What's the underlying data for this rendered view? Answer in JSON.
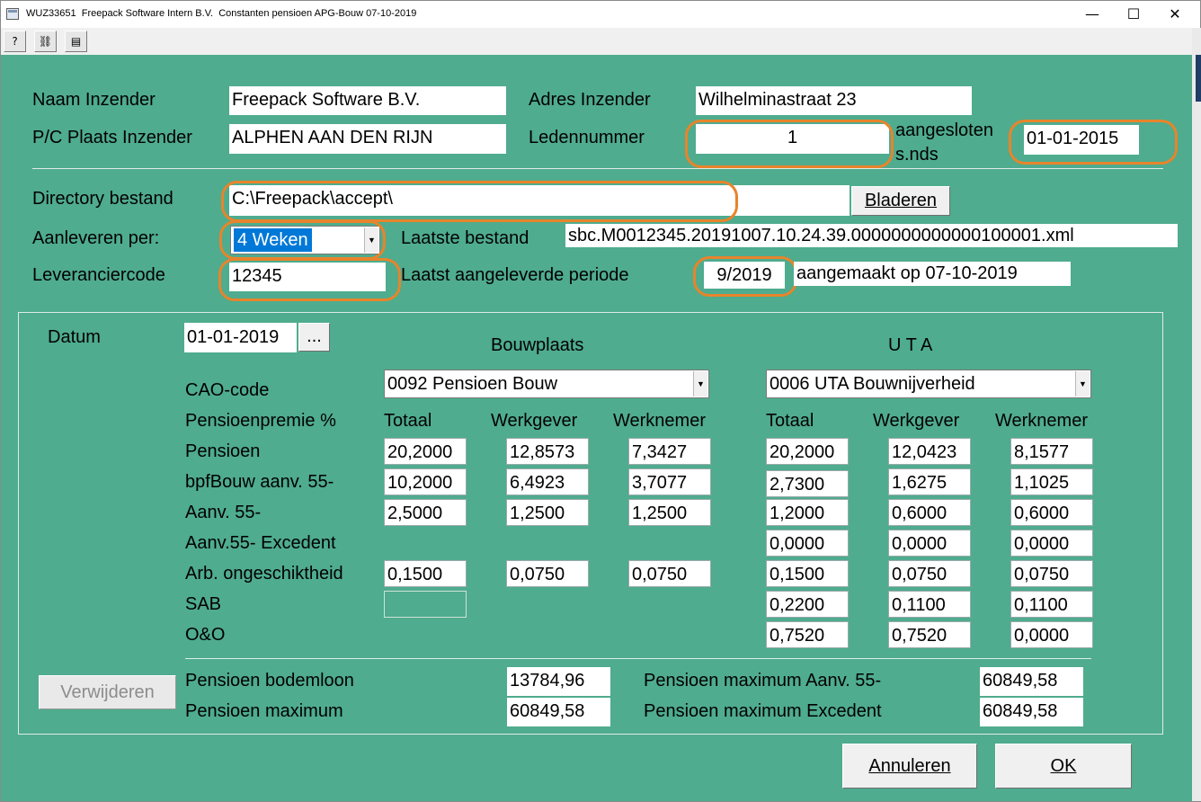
{
  "window": {
    "title": "WUZ33651  Freepack Software Intern B.V.  Constanten pensioen APG-Bouw 07-10-2019",
    "minimize": "—",
    "maximize": "☐",
    "close": "✕"
  },
  "toolbar": {
    "help_icon": "?",
    "find_icon": "⛓",
    "print_icon": "▤"
  },
  "header": {
    "naam_label": "Naam  Inzender",
    "naam_value": "Freepack Software B.V.",
    "adres_label": "Adres Inzender",
    "adres_value": "Wilhelminastraat 23",
    "pc_label": "P/C Plaats Inzender",
    "pc_value": "ALPHEN AAN DEN RIJN",
    "leden_label": "Ledennummer",
    "leden_value": "1",
    "aangesloten_label_1": "aangesloten",
    "aangesloten_label_2": "s.nds",
    "aangesloten_value": "01-01-2015",
    "directory_label": "Directory bestand",
    "directory_value": "C:\\Freepack\\accept\\",
    "bladeren": "Bladeren",
    "aanleveren_label": "Aanleveren per:",
    "aanleveren_value": "4 Weken",
    "laatste_label": "Laatste bestand",
    "laatste_value": "sbc.M0012345.20191007.10.24.39.0000000000000100001.xml",
    "leverancier_label": "Leveranciercode",
    "leverancier_value": "12345",
    "periode_label": "Laatst aangeleverde periode",
    "periode_value": "9/2019",
    "aangemaakt_value": "aangemaakt op 07-10-2019"
  },
  "group": {
    "datum_label": "Datum",
    "datum_value": "01-01-2019",
    "datum_button": "...",
    "bouwplaats_title": "Bouwplaats",
    "uta_title": "U T A",
    "cao_label": "CAO-code",
    "cao_bouw": "0092 Pensioen Bouw",
    "cao_uta": "0006 UTA Bouwnijverheid",
    "premie_label": "Pensioenpremie %",
    "col_totaal": "Totaal",
    "col_werkgever": "Werkgever",
    "col_werknemer": "Werknemer",
    "rows": [
      {
        "label": "Pensioen",
        "b": [
          "20,2000",
          "12,8573",
          "7,3427"
        ],
        "u": [
          "20,2000",
          "12,0423",
          "8,1577"
        ]
      },
      {
        "label": "bpfBouw aanv. 55-",
        "b": [
          "10,2000",
          "6,4923",
          "3,7077"
        ],
        "u": [
          "2,7300",
          "1,6275",
          "1,1025"
        ]
      },
      {
        "label": "Aanv. 55-",
        "b": [
          "2,5000",
          "1,2500",
          "1,2500"
        ],
        "u": [
          "1,2000",
          "0,6000",
          "0,6000"
        ]
      },
      {
        "label": "Aanv.55- Excedent",
        "u": [
          "0,0000",
          "0,0000",
          "0,0000"
        ]
      },
      {
        "label": "Arb. ongeschiktheid",
        "b": [
          "0,1500",
          "0,0750",
          "0,0750"
        ],
        "u": [
          "0,1500",
          "0,0750",
          "0,0750"
        ]
      },
      {
        "label": "SAB",
        "u": [
          "0,2200",
          "0,1100",
          "0,1100"
        ]
      },
      {
        "label": "O&O",
        "u": [
          "0,7520",
          "0,7520",
          "0,0000"
        ]
      }
    ],
    "bodemloon_label": "Pensioen bodemloon",
    "bodemloon_value": "13784,96",
    "maximum_label": "Pensioen maximum",
    "maximum_value": "60849,58",
    "max_aanv_label": "Pensioen maximum Aanv. 55-",
    "max_aanv_value": "60849,58",
    "max_exc_label": "Pensioen maximum Excedent",
    "max_exc_value": "60849,58",
    "verwijderen": "Verwijderen"
  },
  "footer": {
    "annuleren": "Annuleren",
    "ok": "OK"
  },
  "colors": {
    "background": "#4fac8e",
    "highlight_oval": "#e8842b",
    "selection": "#0078d7"
  }
}
